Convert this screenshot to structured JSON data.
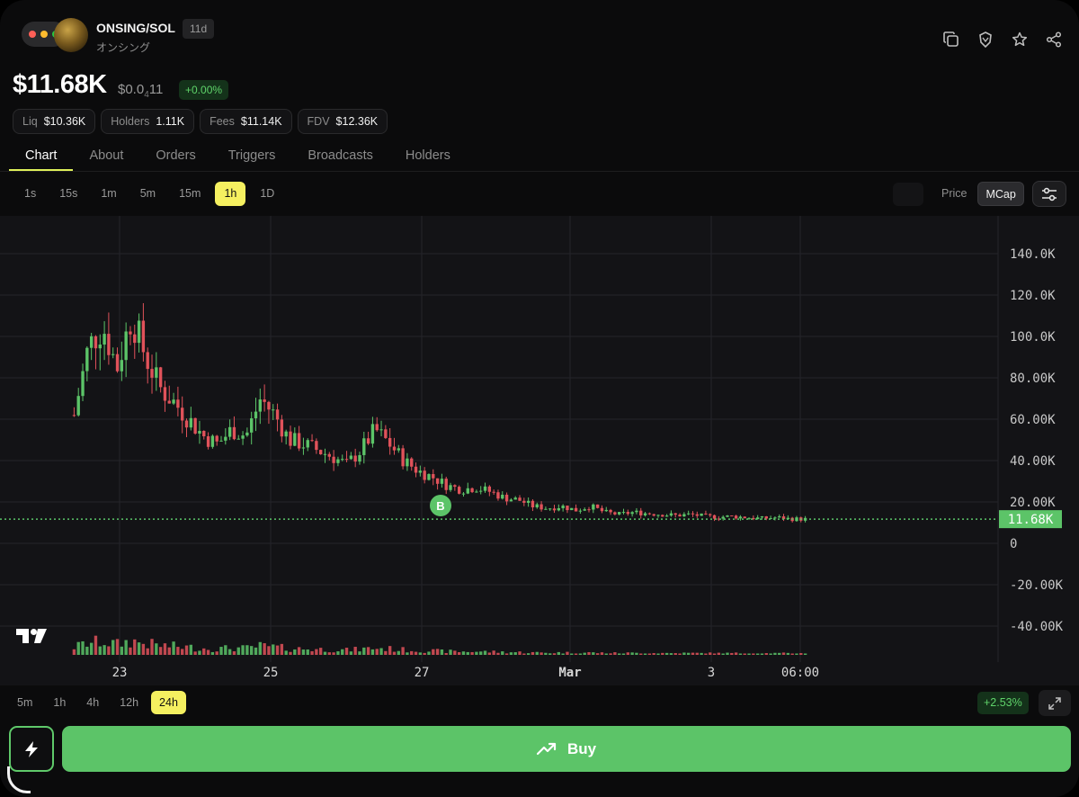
{
  "header": {
    "pair": "ONSING/SOL",
    "age": "11d",
    "subname": "オンシング",
    "icons": [
      "copy-icon",
      "shield-icon",
      "star-icon",
      "share-icon"
    ]
  },
  "price": {
    "mcap": "$11.68K",
    "subprice_main": "$0.0",
    "subprice_zeros": "4",
    "subprice_tail": "11",
    "change": "+0.00%"
  },
  "stats": [
    {
      "label": "Liq",
      "value": "$10.36K"
    },
    {
      "label": "Holders",
      "value": "1.11K"
    },
    {
      "label": "Fees",
      "value": "$11.14K"
    },
    {
      "label": "FDV",
      "value": "$12.36K"
    }
  ],
  "tabs": [
    "Chart",
    "About",
    "Orders",
    "Triggers",
    "Broadcasts",
    "Holders"
  ],
  "active_tab": "Chart",
  "intervals": [
    "1s",
    "15s",
    "1m",
    "5m",
    "15m",
    "1h",
    "1D"
  ],
  "active_interval": "1h",
  "view_modes": [
    "Price",
    "MCap"
  ],
  "active_view_mode": "MCap",
  "chart_data": {
    "type": "candlestick",
    "y_axis_labels": [
      "140.0K",
      "120.0K",
      "100.0K",
      "80.00K",
      "60.00K",
      "40.00K",
      "20.00K",
      "0",
      "-20.00K",
      "-40.00K"
    ],
    "ylim": [
      -45000,
      150000
    ],
    "x_axis_labels": [
      "23",
      "25",
      "27",
      "Mar",
      "3",
      "06:00"
    ],
    "current_value_label": "11.68K",
    "current_value": 11680,
    "marker": {
      "label": "B",
      "color": "#5cc468"
    },
    "close_series_approx": [
      62000,
      95000,
      105000,
      85000,
      110000,
      90000,
      75000,
      68000,
      60000,
      52000,
      48000,
      55000,
      52000,
      70000,
      62000,
      50000,
      48000,
      45000,
      42000,
      38000,
      45000,
      55000,
      48000,
      40000,
      35000,
      32000,
      28000,
      26000,
      27000,
      25000,
      22000,
      21000,
      18000,
      17000,
      18000,
      16000,
      18000,
      15000,
      14000,
      15000,
      14500,
      14000,
      13500,
      14000,
      13000,
      12800,
      13000,
      12500,
      12000,
      12500,
      11800,
      11680
    ],
    "colors": {
      "up": "#5cc468",
      "down": "#e0525a",
      "grid": "#24242a",
      "axis_text": "#c8c8c8"
    }
  },
  "ranges": [
    "5m",
    "1h",
    "4h",
    "12h",
    "24h"
  ],
  "active_range": "24h",
  "range_change": "+2.53%",
  "buy_label": "Buy"
}
